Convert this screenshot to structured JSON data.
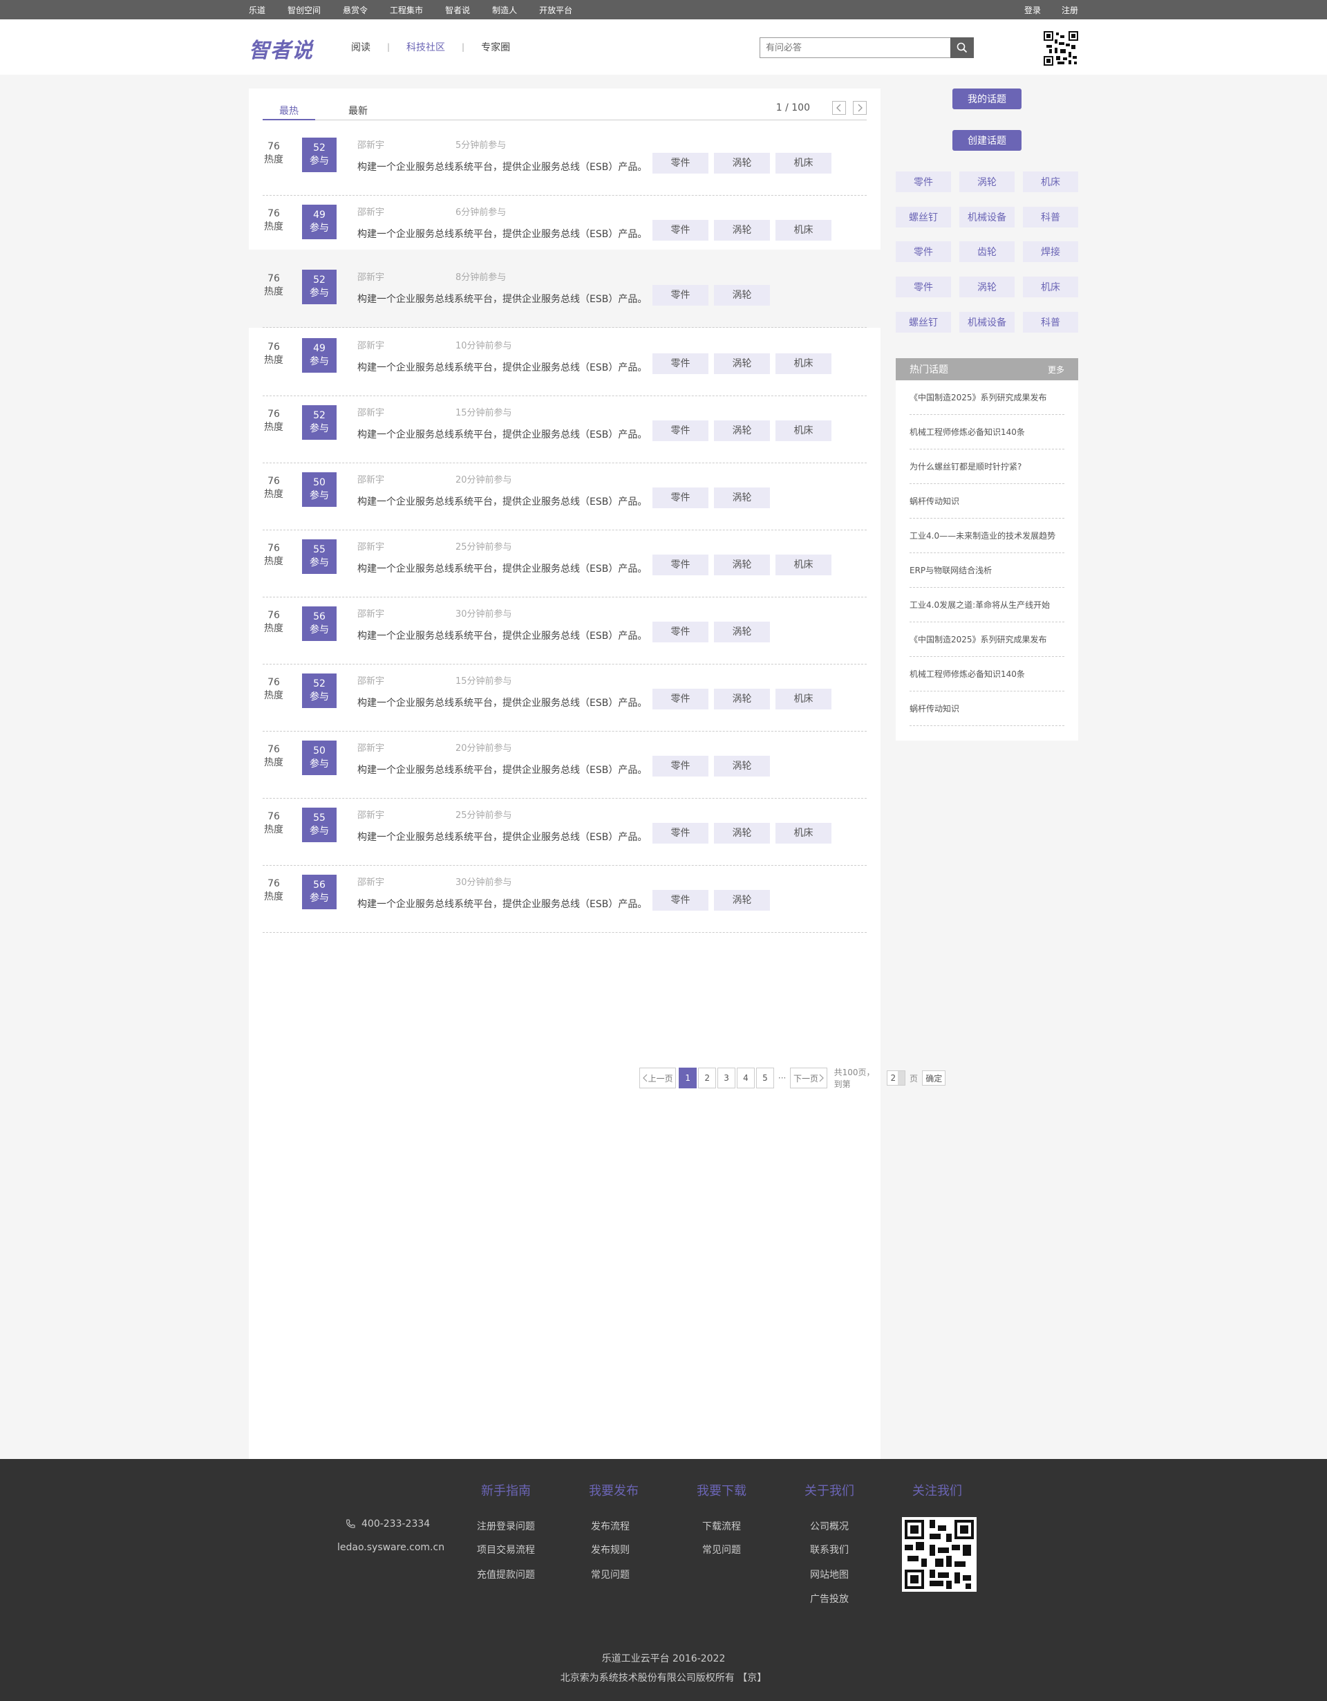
{
  "topbar": {
    "links": [
      "乐道",
      "智创空间",
      "悬赏令",
      "工程集市",
      "智者说",
      "制造人",
      "开放平台"
    ],
    "login": "登录",
    "register": "注册"
  },
  "header": {
    "logo": "智者说",
    "nav": [
      "阅读",
      "科技社区",
      "专家圈"
    ],
    "active_nav": "科技社区",
    "search_placeholder": "有问必答"
  },
  "tabs": {
    "hot": "最热",
    "latest": "最新",
    "page_count": "1 / 100"
  },
  "rows": [
    {
      "heat": "76",
      "heat_label": "热度",
      "participants": "52",
      "part_label": "参与",
      "user": "邵新宇",
      "time": "5分钟前参与",
      "desc": "构建一个企业服务总线系统平台，提供企业服务总线（ESB）产品。",
      "tags": [
        "零件",
        "涡轮",
        "机床"
      ]
    },
    {
      "heat": "76",
      "heat_label": "热度",
      "participants": "49",
      "part_label": "参与",
      "user": "邵新宇",
      "time": "6分钟前参与",
      "desc": "构建一个企业服务总线系统平台，提供企业服务总线（ESB）产品。",
      "tags": [
        "零件",
        "涡轮",
        "机床"
      ]
    },
    {
      "heat": "76",
      "heat_label": "热度",
      "participants": "52",
      "part_label": "参与",
      "user": "邵新宇",
      "time": "8分钟前参与",
      "desc": "构建一个企业服务总线系统平台，提供企业服务总线（ESB）产品。",
      "tags": [
        "零件",
        "涡轮"
      ]
    },
    {
      "heat": "76",
      "heat_label": "热度",
      "participants": "49",
      "part_label": "参与",
      "user": "邵新宇",
      "time": "10分钟前参与",
      "desc": "构建一个企业服务总线系统平台，提供企业服务总线（ESB）产品。",
      "tags": [
        "零件",
        "涡轮",
        "机床"
      ]
    },
    {
      "heat": "76",
      "heat_label": "热度",
      "participants": "52",
      "part_label": "参与",
      "user": "邵新宇",
      "time": "15分钟前参与",
      "desc": "构建一个企业服务总线系统平台，提供企业服务总线（ESB）产品。",
      "tags": [
        "零件",
        "涡轮",
        "机床"
      ]
    },
    {
      "heat": "76",
      "heat_label": "热度",
      "participants": "50",
      "part_label": "参与",
      "user": "邵新宇",
      "time": "20分钟前参与",
      "desc": "构建一个企业服务总线系统平台，提供企业服务总线（ESB）产品。",
      "tags": [
        "零件",
        "涡轮"
      ]
    },
    {
      "heat": "76",
      "heat_label": "热度",
      "participants": "55",
      "part_label": "参与",
      "user": "邵新宇",
      "time": "25分钟前参与",
      "desc": "构建一个企业服务总线系统平台，提供企业服务总线（ESB）产品。",
      "tags": [
        "零件",
        "涡轮",
        "机床"
      ]
    },
    {
      "heat": "76",
      "heat_label": "热度",
      "participants": "56",
      "part_label": "参与",
      "user": "邵新宇",
      "time": "30分钟前参与",
      "desc": "构建一个企业服务总线系统平台，提供企业服务总线（ESB）产品。",
      "tags": [
        "零件",
        "涡轮"
      ]
    },
    {
      "heat": "76",
      "heat_label": "热度",
      "participants": "52",
      "part_label": "参与",
      "user": "邵新宇",
      "time": "15分钟前参与",
      "desc": "构建一个企业服务总线系统平台，提供企业服务总线（ESB）产品。",
      "tags": [
        "零件",
        "涡轮",
        "机床"
      ]
    },
    {
      "heat": "76",
      "heat_label": "热度",
      "participants": "50",
      "part_label": "参与",
      "user": "邵新宇",
      "time": "20分钟前参与",
      "desc": "构建一个企业服务总线系统平台，提供企业服务总线（ESB）产品。",
      "tags": [
        "零件",
        "涡轮"
      ]
    },
    {
      "heat": "76",
      "heat_label": "热度",
      "participants": "55",
      "part_label": "参与",
      "user": "邵新宇",
      "time": "25分钟前参与",
      "desc": "构建一个企业服务总线系统平台，提供企业服务总线（ESB）产品。",
      "tags": [
        "零件",
        "涡轮",
        "机床"
      ]
    },
    {
      "heat": "76",
      "heat_label": "热度",
      "participants": "56",
      "part_label": "参与",
      "user": "邵新宇",
      "time": "30分钟前参与",
      "desc": "构建一个企业服务总线系统平台，提供企业服务总线（ESB）产品。",
      "tags": [
        "零件",
        "涡轮"
      ]
    }
  ],
  "pagination": {
    "prev": "上一页",
    "pages": [
      "1",
      "2",
      "3",
      "4",
      "5"
    ],
    "current": "1",
    "ellipsis": "···",
    "next": "下一页",
    "total_text": "共100页，到第",
    "jump_value": "2",
    "page_unit": "页",
    "confirm": "确定"
  },
  "sidebar": {
    "my_topics": "我的话题",
    "create_topic": "创建话题",
    "tags": [
      "零件",
      "涡轮",
      "机床",
      "螺丝钉",
      "机械设备",
      "科普",
      "零件",
      "齿轮",
      "焊接",
      "零件",
      "涡轮",
      "机床",
      "螺丝钉",
      "机械设备",
      "科普"
    ],
    "hot_title": "热门话题",
    "hot_more": "更多",
    "hot_items": [
      "《中国制造2025》系列研究成果发布",
      "机械工程师修炼必备知识140条",
      "为什么螺丝钉都是顺时针拧紧?",
      "蜗杆传动知识",
      "工业4.0——未来制造业的技术发展趋势",
      "ERP与物联网结合浅析",
      "工业4.0发展之道:革命将从生产线开始",
      "《中国制造2025》系列研究成果发布",
      "机械工程师修炼必备知识140条",
      "蜗杆传动知识"
    ]
  },
  "footer": {
    "columns": [
      {
        "title": "新手指南",
        "links": [
          "注册登录问题",
          "项目交易流程",
          "充值提款问题"
        ]
      },
      {
        "title": "我要发布",
        "links": [
          "发布流程",
          "发布规则",
          "常见问题"
        ]
      },
      {
        "title": "我要下载",
        "links": [
          "下载流程",
          "常见问题"
        ]
      },
      {
        "title": "关于我们",
        "links": [
          "公司概况",
          "联系我们",
          "网站地图",
          "广告投放"
        ]
      },
      {
        "title": "关注我们",
        "links": []
      }
    ],
    "phone": "400-233-2334",
    "site": "ledao.sysware.com.cn",
    "copyright": "乐道工业云平台 2016-2022",
    "company": "北京索为系统技术股份有限公司版权所有 【京】"
  },
  "colors": {
    "accent": "#6b65b5",
    "topbar": "#5f5f5f",
    "footer": "#333333",
    "tag_bg": "#ebeaf6"
  }
}
